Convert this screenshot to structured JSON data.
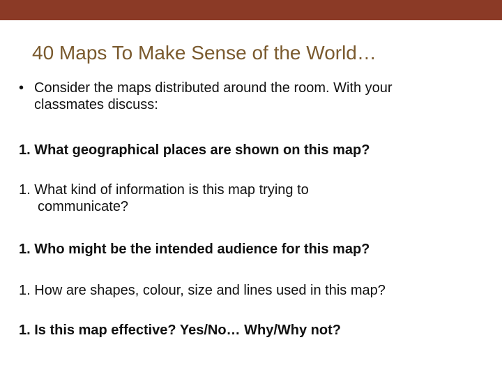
{
  "colors": {
    "top_bar": "#8b3a26",
    "title": "#7a5a2e",
    "text": "#111111"
  },
  "slide": {
    "title": "40 Maps To Make Sense of the World…",
    "intro_bullet": "•",
    "intro_line1": "Consider the maps distributed around the room.  With your",
    "intro_line2": "classmates discuss:",
    "items": [
      {
        "number": "1.",
        "line1": "What geographical places are shown on this map?",
        "line2": "",
        "bold": true
      },
      {
        "number": "1.",
        "line1": "What kind of information is this map trying to",
        "line2": "communicate?",
        "bold": false
      },
      {
        "number": "1.",
        "line1": "Who might be the intended audience for this map?",
        "line2": "",
        "bold": true
      },
      {
        "number": "1.",
        "line1": "How are shapes, colour, size and lines used in this map?",
        "line2": "",
        "bold": false
      },
      {
        "number": "1.",
        "line1": "Is this map effective?  Yes/No… Why/Why not?",
        "line2": "",
        "bold": true
      }
    ]
  }
}
